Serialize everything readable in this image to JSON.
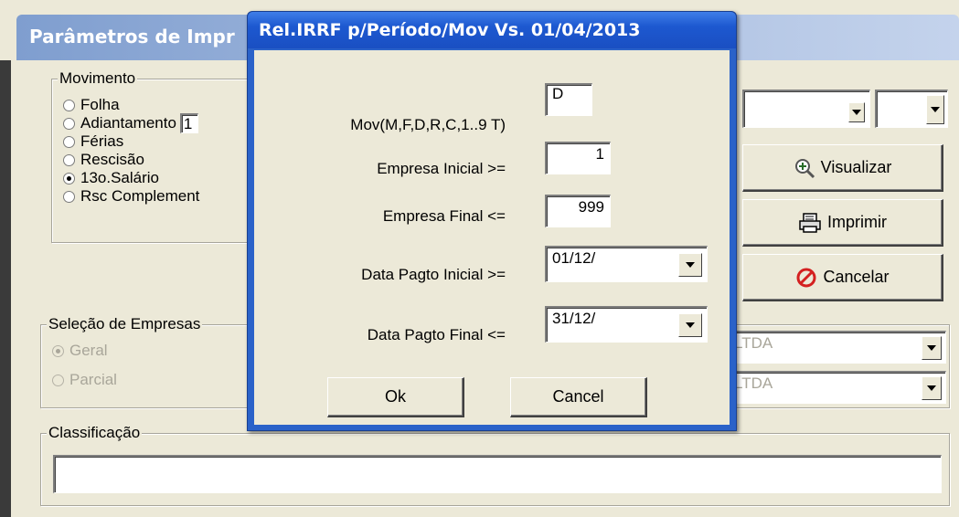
{
  "background": {
    "title": "Parâmetros de Impr",
    "movimento": {
      "legend": "Movimento",
      "options": [
        "Folha",
        "Adiantamento",
        "Férias",
        "Rescisão",
        "13o.Salário",
        "Rsc Complement"
      ],
      "selected": "13o.Salário",
      "adiantamento_value": "1"
    },
    "buttons": {
      "visualizar": "Visualizar",
      "imprimir": "Imprimir",
      "cancelar": "Cancelar"
    },
    "selecao": {
      "legend": "Seleção de Empresas",
      "options": [
        "Geral",
        "Parcial"
      ],
      "selected": "Geral",
      "empresa_inicial_text": "LTDA",
      "empresa_final_text": "LTDA"
    },
    "classificacao": {
      "legend": "Classificação",
      "value": ""
    }
  },
  "dialog": {
    "title": "Rel.IRRF p/Período/Mov Vs. 01/04/2013",
    "fields": {
      "mov": {
        "label": "Mov(M,F,D,R,C,1..9  T)",
        "value": "D"
      },
      "empresa_inicial": {
        "label": "Empresa Inicial >=",
        "value": "1"
      },
      "empresa_final": {
        "label": "Empresa Final <=",
        "value": "999"
      },
      "data_pagto_inicial": {
        "label": "Data Pagto Inicial >=",
        "value": "01/12/"
      },
      "data_pagto_final": {
        "label": "Data Pagto Final <=",
        "value": "31/12/"
      }
    },
    "ok_label": "Ok",
    "cancel_label": "Cancel"
  },
  "colors": {
    "dialog_title_bg": "#1d58d0",
    "background_title_bg": "#a8bde0",
    "window_bg": "#ece9d8",
    "cancel_icon_red": "#d42020"
  }
}
